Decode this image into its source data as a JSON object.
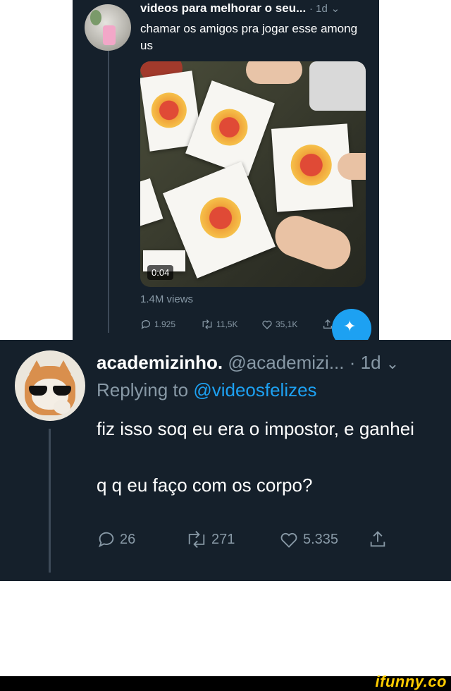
{
  "tweet1": {
    "name": "videos para melhorar o seu...",
    "meta": "· 1d",
    "text": "chamar os amigos pra jogar esse among us",
    "media_duration": "0:04",
    "views": "1.4M views",
    "replies": "1.925",
    "retweets": "11,5K",
    "likes": "35,1K"
  },
  "tweet2": {
    "name": "academizinho.",
    "handle": "@academizi...",
    "meta": "· 1d",
    "reply_prefix": "Replying to",
    "reply_mention": "@videosfelizes",
    "text_line1": "fiz isso soq eu era o impostor, e ganhei",
    "text_line2": "q q eu faço com os corpo?",
    "replies": "26",
    "retweets": "271",
    "likes": "5.335"
  },
  "footer": {
    "logo": "ifunny.co"
  },
  "colors": {
    "bg": "#15202b",
    "muted": "#8899a6",
    "accent": "#1da1f2",
    "logo": "#ffcc00"
  }
}
